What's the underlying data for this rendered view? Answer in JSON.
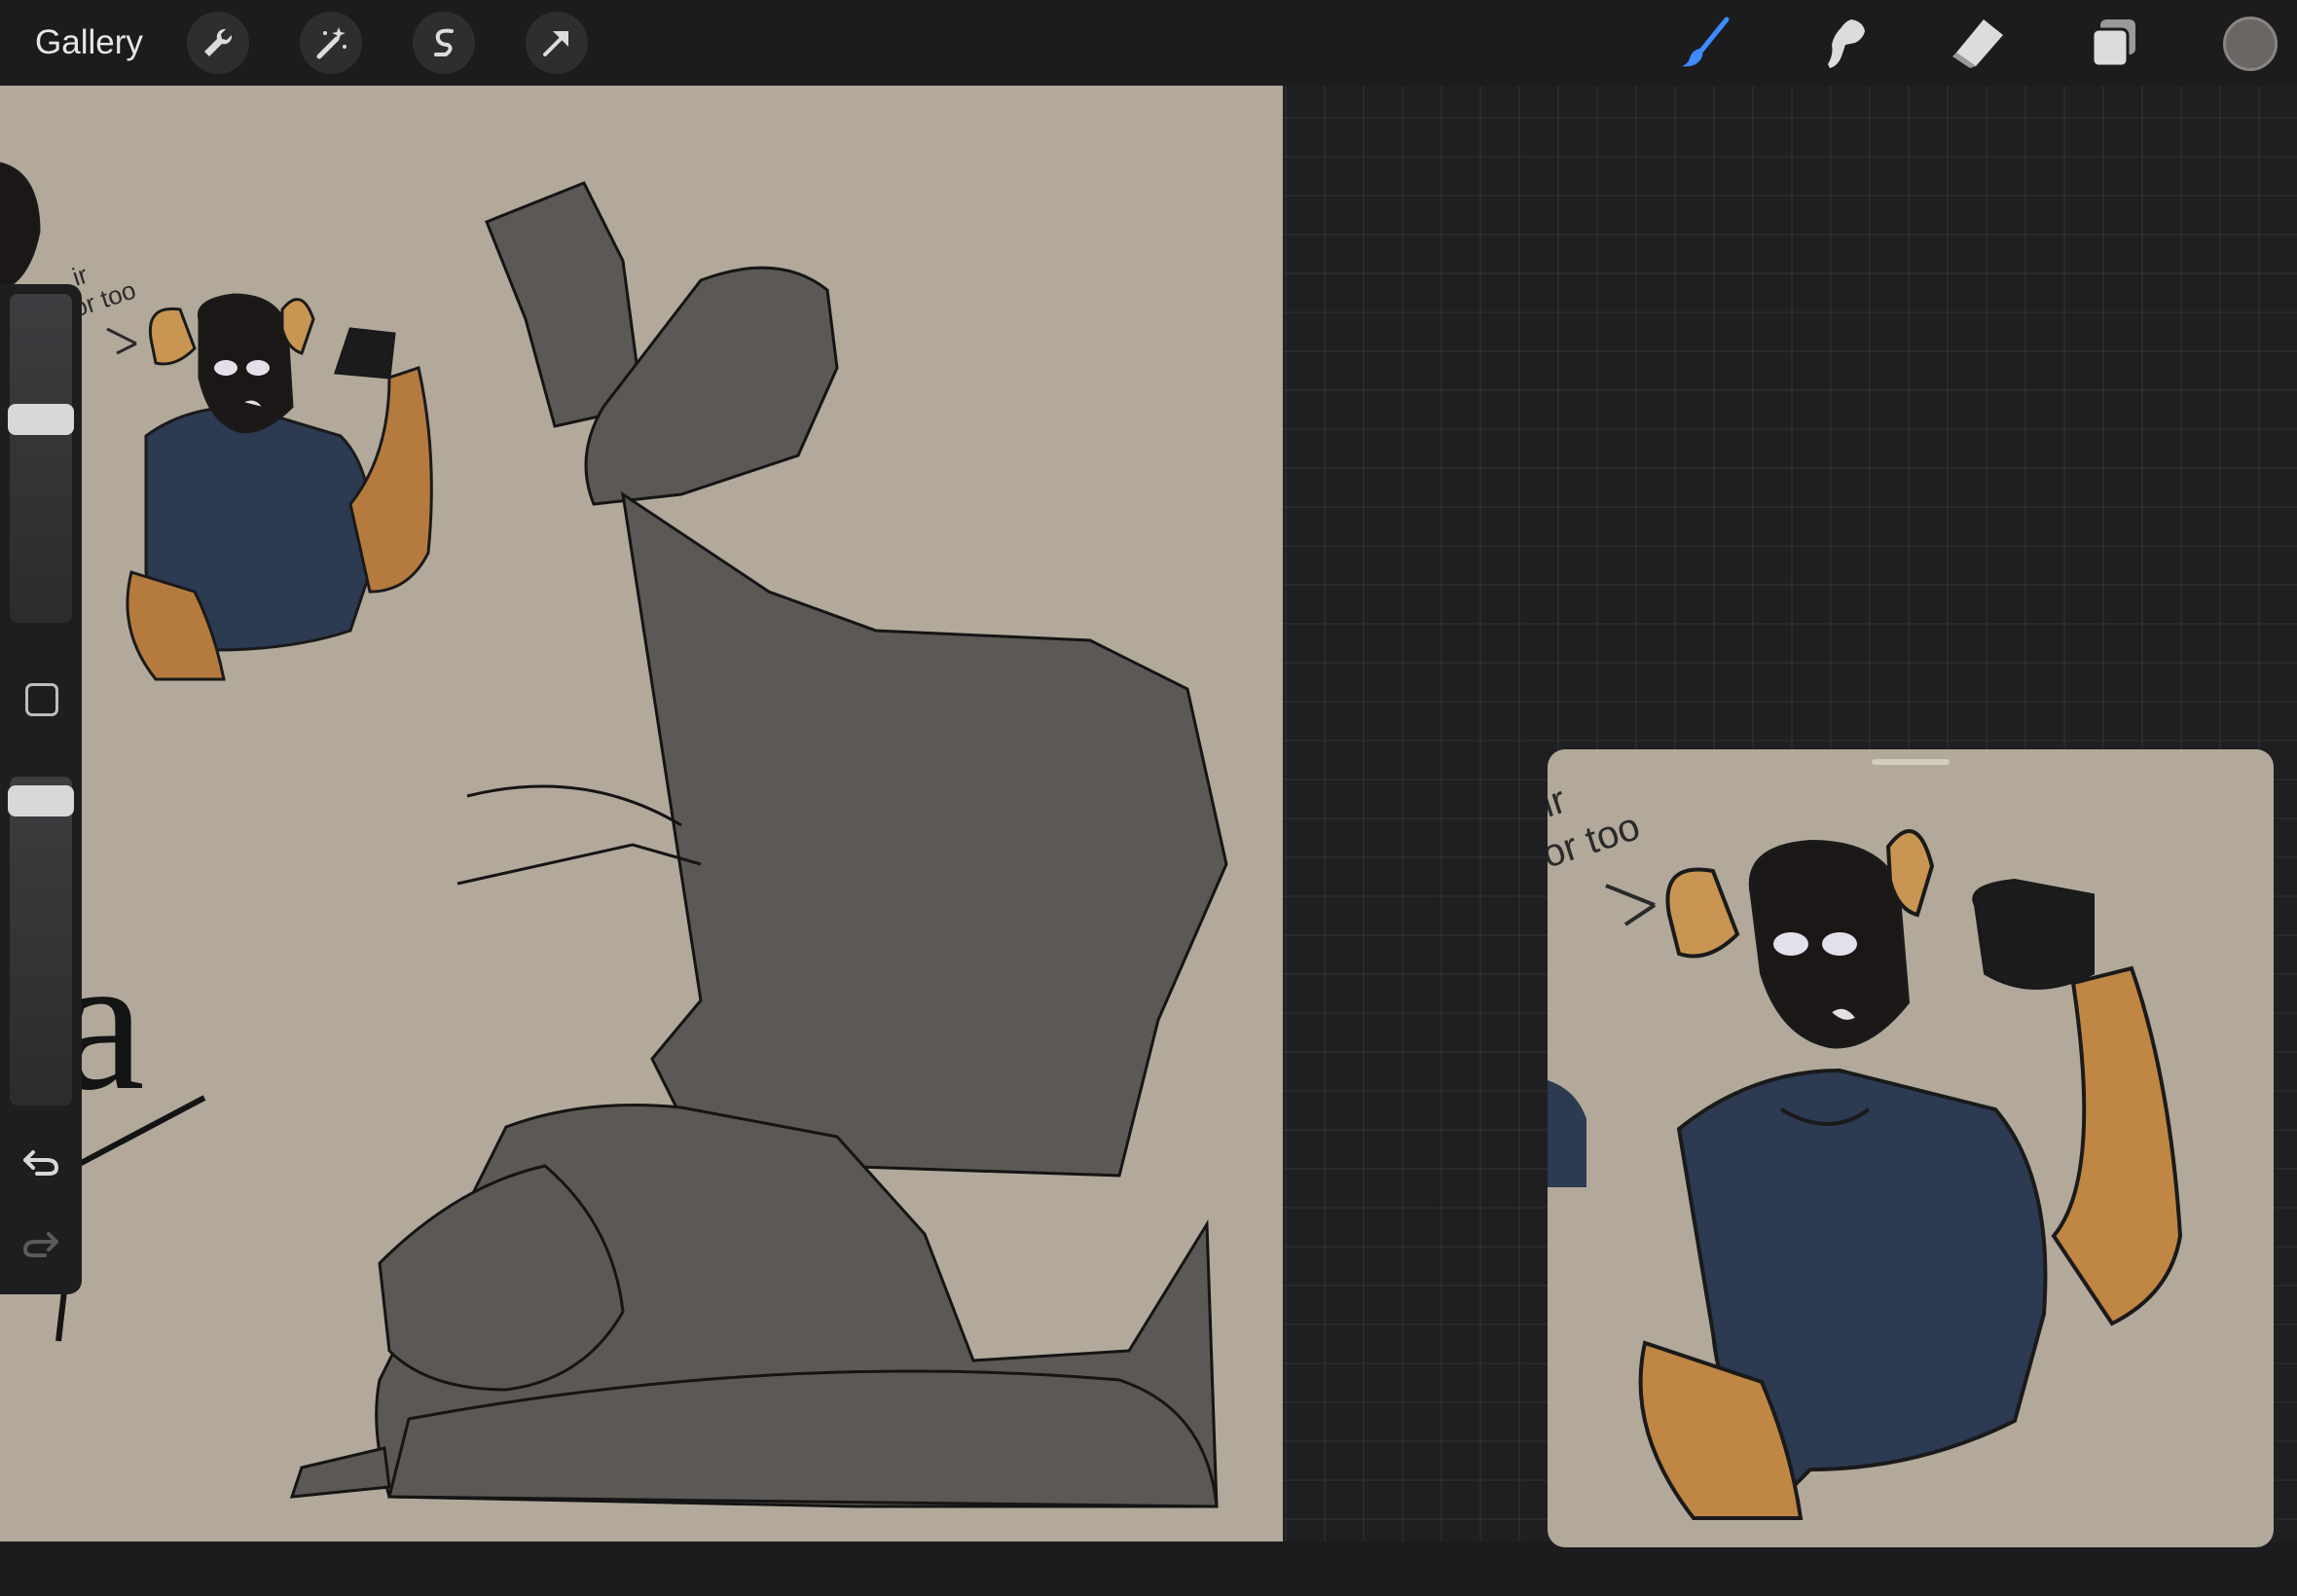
{
  "toolbar": {
    "gallery_label": "Gallery",
    "left_tools": [
      "wrench-icon",
      "magic-wand-icon",
      "selection-icon",
      "transform-arrow-icon"
    ],
    "right_tools": [
      "brush-icon",
      "smudge-icon",
      "eraser-icon",
      "layers-icon"
    ],
    "active_tool": "brush-icon",
    "accent_color": "#3d8bff",
    "current_color": "#6b6563"
  },
  "canvas": {
    "background_color": "#b2a99b",
    "visible_text": [
      "ir",
      "or too",
      "a"
    ]
  },
  "sidebar": {
    "brush_size_level": 0.63,
    "opacity_level": 0.97
  },
  "reference_window": {
    "visible_text": [
      "ir",
      "or too"
    ]
  }
}
